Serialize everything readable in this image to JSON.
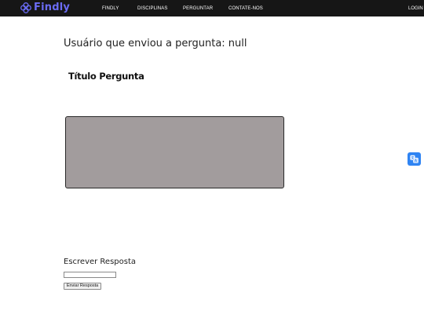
{
  "navbar": {
    "brand": "Findly",
    "links": [
      {
        "label": "FINDLY"
      },
      {
        "label": "DISCIPLINAS"
      },
      {
        "label": "PERGUNTAR"
      },
      {
        "label": "CONTATE-NOS"
      }
    ],
    "login_label": "LOGIN O"
  },
  "question": {
    "author_line": "Usuário que enviou a pergunta: null",
    "title": "Título Pergunta",
    "body": ""
  },
  "answer": {
    "label": "Escrever Resposta",
    "input_value": "",
    "submit_label": "Enviar Resposta"
  },
  "colors": {
    "navbar_bg": "#161616",
    "brand": "#6b6cf5",
    "question_box": "#a29c9d",
    "translate_widget": "#2f84f3"
  },
  "icons": {
    "brand_logo": "flower-logo-icon",
    "translate": "translate-icon"
  }
}
